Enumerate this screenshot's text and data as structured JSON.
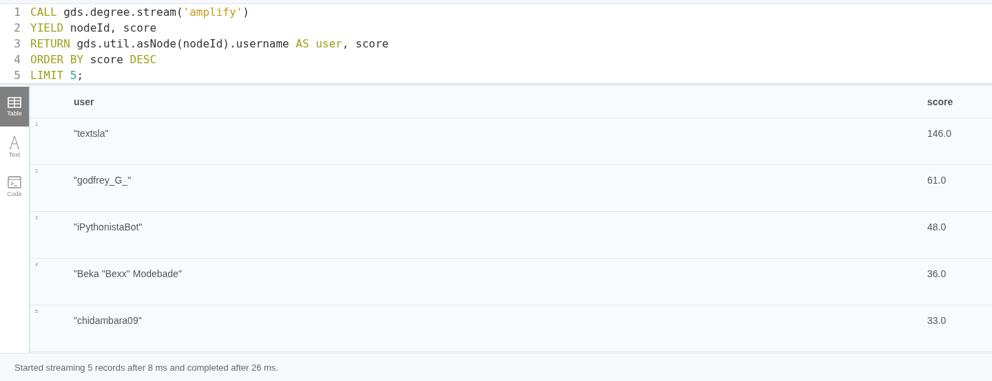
{
  "editor": {
    "lines": [
      {
        "number": "1",
        "tokens": [
          {
            "kind": "keyword",
            "text": "CALL"
          },
          {
            "kind": "plain",
            "text": " gds.degree.stream("
          },
          {
            "kind": "string",
            "text": "'amplify'"
          },
          {
            "kind": "plain",
            "text": ")"
          }
        ]
      },
      {
        "number": "2",
        "tokens": [
          {
            "kind": "keyword",
            "text": "YIELD"
          },
          {
            "kind": "plain",
            "text": " nodeId, score"
          }
        ]
      },
      {
        "number": "3",
        "tokens": [
          {
            "kind": "keyword",
            "text": "RETURN"
          },
          {
            "kind": "plain",
            "text": " gds.util.asNode(nodeId).username "
          },
          {
            "kind": "keyword",
            "text": "AS"
          },
          {
            "kind": "keyword",
            "text": " user"
          },
          {
            "kind": "plain",
            "text": ", score"
          }
        ]
      },
      {
        "number": "4",
        "tokens": [
          {
            "kind": "keyword",
            "text": "ORDER BY"
          },
          {
            "kind": "plain",
            "text": " score "
          },
          {
            "kind": "keyword",
            "text": "DESC"
          }
        ]
      },
      {
        "number": "5",
        "tokens": [
          {
            "kind": "keyword",
            "text": "LIMIT"
          },
          {
            "kind": "number",
            "text": " 5"
          },
          {
            "kind": "plain",
            "text": ";"
          }
        ]
      }
    ]
  },
  "sidebar": {
    "items": [
      {
        "kind": "table",
        "label": "Table",
        "selected": true
      },
      {
        "kind": "text",
        "label": "Text",
        "selected": false
      },
      {
        "kind": "code",
        "label": "Code",
        "selected": false
      }
    ]
  },
  "table": {
    "columns": [
      "user",
      "score"
    ],
    "rows": [
      {
        "index": "1",
        "user": "\"textsla\"",
        "score": "146.0"
      },
      {
        "index": "2",
        "user": "\"godfrey_G_\"",
        "score": "61.0"
      },
      {
        "index": "3",
        "user": "\"iPythonistaBot\"",
        "score": "48.0"
      },
      {
        "index": "4",
        "user": "\"Beka \"Bexx\" Modebade\"",
        "score": "36.0"
      },
      {
        "index": "5",
        "user": "\"chidambara09\"",
        "score": "33.0"
      }
    ]
  },
  "status_bar": "Started streaming 5 records after 8 ms and completed after 26 ms."
}
